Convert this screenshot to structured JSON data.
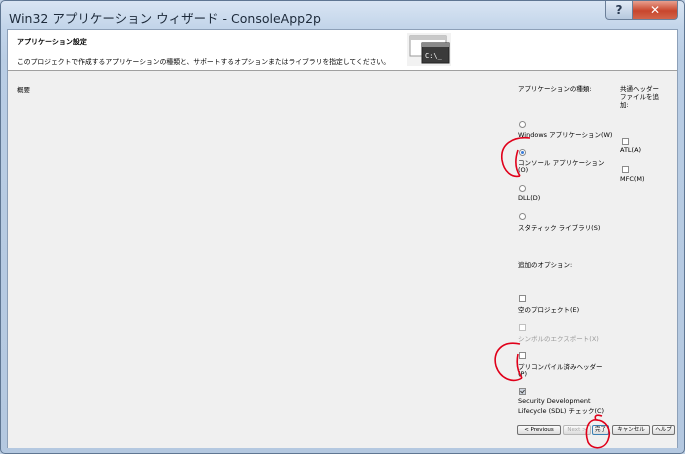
{
  "window": {
    "title": "Win32 アプリケーション ウィザード - ConsoleApp2p",
    "help_label": "?",
    "close_label": "✕"
  },
  "header": {
    "title": "アプリケーション設定",
    "description": "このプロジェクトで作成するアプリケーションの種類と、サポートするオプションまたはライブラリを指定してください。"
  },
  "left": {
    "summary_label": "概要"
  },
  "app_type": {
    "heading": "アプリケーションの種類:",
    "selected": "console",
    "options": [
      {
        "id": "windows",
        "label": "Windows アプリケーション(W)"
      },
      {
        "id": "console",
        "label_line1": "コンソール アプリケーション",
        "label_line2": "(O)"
      },
      {
        "id": "dll",
        "label": "DLL(D)"
      },
      {
        "id": "static",
        "label": "スタティック ライブラリ(S)"
      }
    ]
  },
  "common_headers": {
    "heading_line1": "共通ヘッダー",
    "heading_line2": "ファイルを追",
    "heading_line3": "加:",
    "atl": "ATL(A)",
    "mfc": "MFC(M)"
  },
  "additional": {
    "heading": "追加のオプション:",
    "empty_project": "空のプロジェクト(E)",
    "export_symbols": "シンボルのエクスポート(X)",
    "precompiled_line1": "プリコンパイル済みヘッダー",
    "precompiled_line2": "(P)",
    "sdl_line1": "Security Development",
    "sdl_line2": "Lifecycle (SDL) チェック(C)"
  },
  "buttons": {
    "previous": "< Previous",
    "next": "Next >",
    "finish": "完了",
    "cancel": "キャンセル",
    "help": "ヘルプ"
  },
  "console_icon_text": "C:\\_",
  "colors": {
    "annotation": "#e0001a",
    "radio_selected": "#3a7dd8"
  }
}
